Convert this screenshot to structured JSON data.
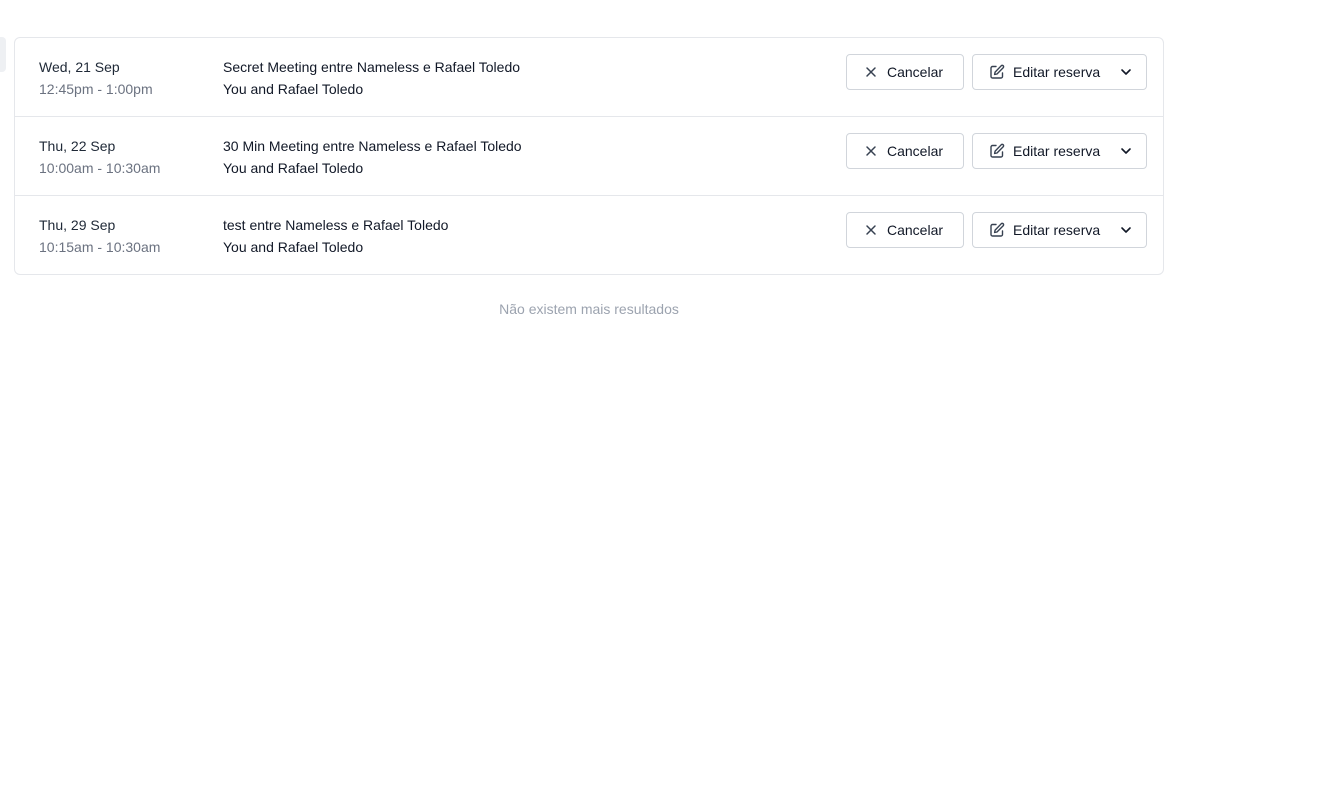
{
  "bookings": [
    {
      "date": "Wed, 21 Sep",
      "time": "12:45pm - 1:00pm",
      "title": "Secret Meeting entre Nameless e Rafael Toledo",
      "attendees": "You and Rafael Toledo",
      "cancel_label": "Cancelar",
      "edit_label": "Editar reserva"
    },
    {
      "date": "Thu, 22 Sep",
      "time": "10:00am - 10:30am",
      "title": "30 Min Meeting entre Nameless e Rafael Toledo",
      "attendees": "You and Rafael Toledo",
      "cancel_label": "Cancelar",
      "edit_label": "Editar reserva"
    },
    {
      "date": "Thu, 29 Sep",
      "time": "10:15am - 10:30am",
      "title": "test entre Nameless e Rafael Toledo",
      "attendees": "You and Rafael Toledo",
      "cancel_label": "Cancelar",
      "edit_label": "Editar reserva"
    }
  ],
  "footer": {
    "no_more_results": "Não existem mais resultados"
  },
  "icons": {
    "cancel": "close-icon",
    "edit": "edit-icon",
    "dropdown": "chevron-down-icon"
  },
  "colors": {
    "border": "#e5e7eb",
    "muted_text": "#6b7280",
    "footer_text": "#9ca3af"
  }
}
